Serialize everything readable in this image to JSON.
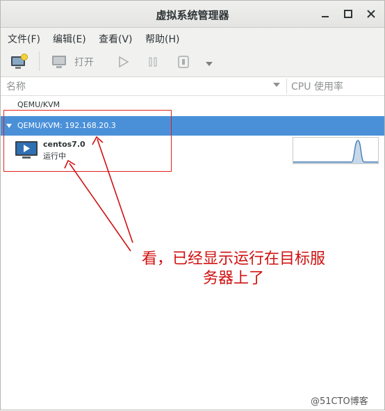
{
  "window": {
    "title": "虚拟系统管理器"
  },
  "menu": [
    "文件(F)",
    "编辑(E)",
    "查看(V)",
    "帮助(H)"
  ],
  "toolbar": {
    "open_label": "打开"
  },
  "columns": {
    "name": "名称",
    "cpu": "CPU 使用率"
  },
  "connections": [
    {
      "label": "QEMU/KVM"
    },
    {
      "label": "QEMU/KVM: 192.168.20.3",
      "selected": true
    }
  ],
  "vm": {
    "name": "centos7.0",
    "status": "运行中"
  },
  "annotation": {
    "line1": "看，已经显示运行在目标服",
    "line2": "务器上了"
  },
  "watermark": "@51CTO博客",
  "colors": {
    "selection": "#4a90d9",
    "annotation": "#d01010",
    "graph": "#4a7fb5"
  }
}
